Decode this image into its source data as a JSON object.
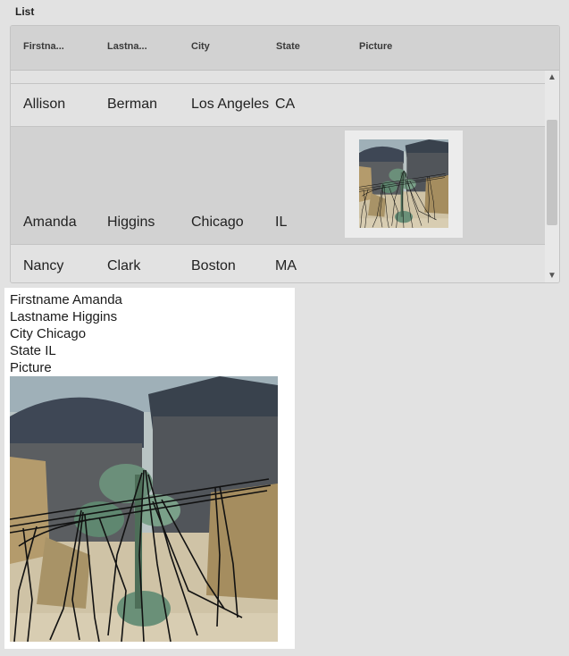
{
  "panel": {
    "title": "List"
  },
  "columns": [
    {
      "label": "Firstna..."
    },
    {
      "label": "Lastna..."
    },
    {
      "label": "City"
    },
    {
      "label": "State"
    },
    {
      "label": "Picture"
    }
  ],
  "rows": [
    {
      "firstname": "Allison",
      "lastname": "Berman",
      "city": "Los Angeles",
      "state": "CA",
      "has_picture": false
    },
    {
      "firstname": "Amanda",
      "lastname": "Higgins",
      "city": "Chicago",
      "state": "IL",
      "has_picture": true,
      "selected": true
    },
    {
      "firstname": "Nancy",
      "lastname": "Clark",
      "city": "Boston",
      "state": "MA",
      "has_picture": false
    }
  ],
  "scrollbar": {
    "up_icon": "chevron-up-icon",
    "down_icon": "chevron-down-icon"
  },
  "detail": {
    "firstname_line": "Firstname Amanda",
    "lastname_line": "Lastname Higgins",
    "city_line": "City Chicago",
    "state_line": "State IL",
    "picture_label": "Picture"
  },
  "colors": {
    "selected_row": "#d2d2d2",
    "row": "#e2e2e2",
    "header": "#d2d2d2",
    "detail_bg": "#ffffff"
  }
}
